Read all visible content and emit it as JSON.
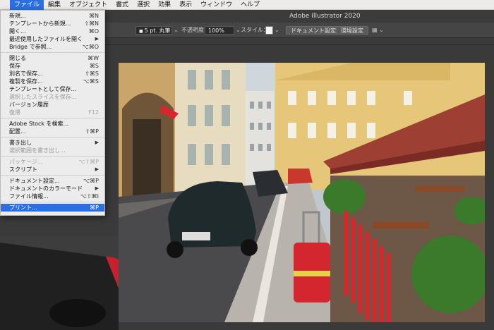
{
  "menubar": {
    "items": [
      {
        "label": "ファイル",
        "active": true
      },
      {
        "label": "編集"
      },
      {
        "label": "オブジェクト"
      },
      {
        "label": "書式"
      },
      {
        "label": "選択"
      },
      {
        "label": "効果"
      },
      {
        "label": "表示"
      },
      {
        "label": "ウィンドウ"
      },
      {
        "label": "ヘルプ"
      }
    ]
  },
  "titlebar": {
    "title": "Adobe Illustrator 2020"
  },
  "toolbar": {
    "stroke_value": "5 pt. 丸筆",
    "opacity_label": "不透明度：",
    "opacity_value": "100%",
    "style_label": "スタイル：",
    "doc_settings": "ドキュメント設定",
    "env_settings": "環境設定"
  },
  "file_menu": {
    "items": [
      {
        "label": "新規...",
        "shortcut": "⌘N"
      },
      {
        "label": "テンプレートから新規...",
        "shortcut": "⇧⌘N"
      },
      {
        "label": "開く...",
        "shortcut": "⌘O"
      },
      {
        "label": "最近使用したファイルを開く",
        "submenu": "▶"
      },
      {
        "label": "Bridge で参照...",
        "shortcut": "⌥⌘O"
      },
      {
        "sep": true
      },
      {
        "label": "閉じる",
        "shortcut": "⌘W"
      },
      {
        "label": "保存",
        "shortcut": "⌘S"
      },
      {
        "label": "別名で保存...",
        "shortcut": "⇧⌘S"
      },
      {
        "label": "複製を保存...",
        "shortcut": "⌥⌘S"
      },
      {
        "label": "テンプレートとして保存..."
      },
      {
        "label": "選択したスライスを保存...",
        "disabled": true
      },
      {
        "label": "バージョン履歴"
      },
      {
        "label": "復帰",
        "shortcut": "F12",
        "disabled": true
      },
      {
        "sep": true
      },
      {
        "label": "Adobe Stock を検索..."
      },
      {
        "label": "配置...",
        "shortcut": "⇧⌘P"
      },
      {
        "sep": true
      },
      {
        "label": "書き出し",
        "submenu": "▶"
      },
      {
        "label": "選択範囲を書き出し...",
        "disabled": true
      },
      {
        "sep": true
      },
      {
        "label": "パッケージ...",
        "shortcut": "⌥⇧⌘P",
        "disabled": true
      },
      {
        "label": "スクリプト",
        "submenu": "▶"
      },
      {
        "sep": true
      },
      {
        "label": "ドキュメント設定...",
        "shortcut": "⌥⌘P"
      },
      {
        "label": "ドキュメントのカラーモード",
        "submenu": "▶"
      },
      {
        "label": "ファイル情報...",
        "shortcut": "⌥⇧⌘I"
      },
      {
        "sep": true
      },
      {
        "label": "プリント...",
        "shortcut": "⌘P",
        "highlighted": true
      }
    ]
  },
  "colors": {
    "menu_highlight": "#2c6fe0",
    "app_bg": "#3a3a3a",
    "toolbar_bg": "#454545"
  }
}
